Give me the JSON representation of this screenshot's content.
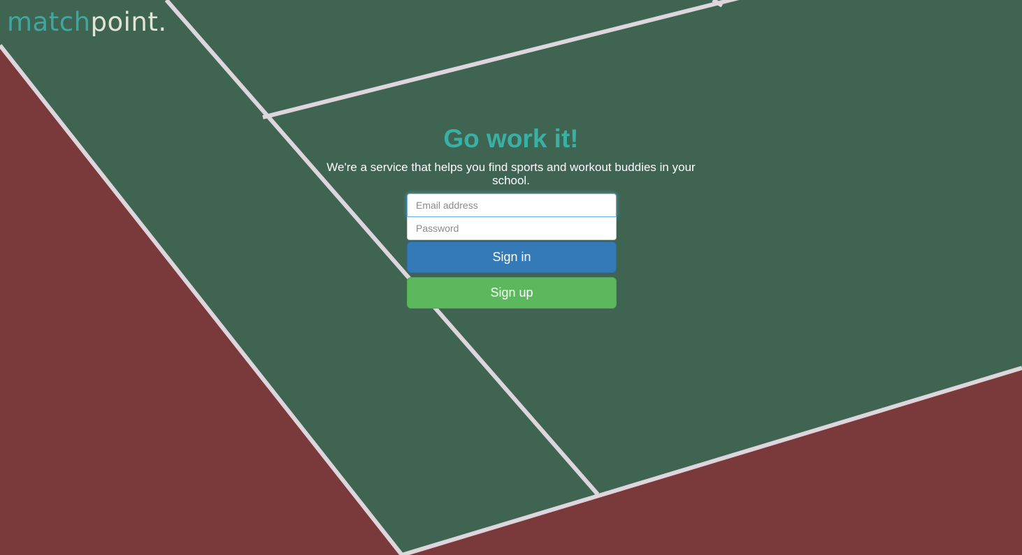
{
  "brand": {
    "name_part1": "match",
    "name_part2": "point."
  },
  "hero": {
    "title": "Go work it!",
    "subtitle": "We're a service that helps you find sports and workout buddies in your school."
  },
  "form": {
    "email_placeholder": "Email address",
    "email_value": "",
    "password_placeholder": "Password",
    "password_value": "",
    "signin_label": "Sign in",
    "signup_label": "Sign up"
  },
  "colors": {
    "court_green": "#3f6552",
    "court_red": "#7a3a3b",
    "court_lines": "#ddd6dc",
    "brand_teal": "#3fa7a1",
    "title_teal": "#3ab0a5",
    "signin_blue": "#337ab7",
    "signup_green": "#5cb85c"
  }
}
